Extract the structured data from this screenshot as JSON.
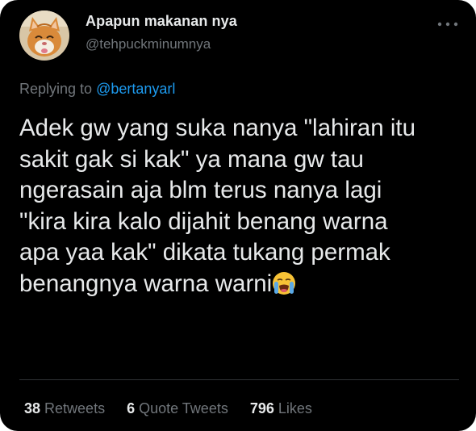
{
  "tweet": {
    "author": {
      "display_name": "Apapun makanan nya",
      "handle": "@tehpuckminumnya",
      "avatar": "cat-avatar"
    },
    "more_icon": "more-horizontal-icon",
    "reply": {
      "prefix": "Replying to",
      "mention": "@bertanyarl"
    },
    "text": "Adek gw yang suka nanya \"lahiran itu\nsakit gak si kak\" ya mana gw tau\nngerasain aja blm terus nanya lagi\n\"kira kira kalo dijahit benang warna\napa yaa kak\" dikata tukang permak\nbenangnya warna warni",
    "emoji": "loudly-crying-face-emoji",
    "stats": [
      {
        "count": "38",
        "label": "Retweets"
      },
      {
        "count": "6",
        "label": "Quote Tweets"
      },
      {
        "count": "796",
        "label": "Likes"
      }
    ]
  },
  "colors": {
    "background": "#000000",
    "text_primary": "#e7e9ea",
    "text_secondary": "#71767b",
    "accent": "#1d9bf0",
    "divider": "#2f3336"
  }
}
